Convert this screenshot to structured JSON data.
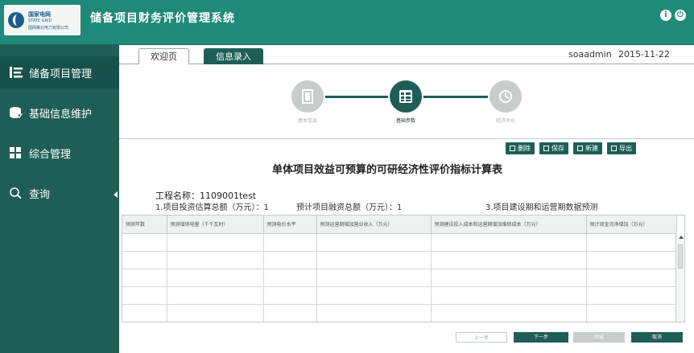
{
  "header": {
    "logo_line1": "国家电网",
    "logo_line2": "STATE GRID",
    "logo_line3": "国网冀北电力有限公司",
    "title": "储备项目财务评价管理系统"
  },
  "sidebar": {
    "items": [
      {
        "label": "储备项目管理",
        "icon": "list-icon"
      },
      {
        "label": "基础信息维护",
        "icon": "database-icon"
      },
      {
        "label": "综合管理",
        "icon": "grid-icon"
      },
      {
        "label": "查询",
        "icon": "search-icon"
      }
    ]
  },
  "tabs": [
    {
      "label": "欢迎页"
    },
    {
      "label": "信息录入"
    }
  ],
  "user": "soaadmin",
  "date": "2015-11-22",
  "steps": [
    {
      "label": "基本信息",
      "icon": "document-icon",
      "state": "inactive"
    },
    {
      "label": "基础参数",
      "icon": "list-grid-icon",
      "state": "active"
    },
    {
      "label": "经济评价",
      "icon": "chart-icon",
      "state": "inactive"
    }
  ],
  "toolbar": {
    "delete": "删除",
    "save": "保存",
    "new": "新建",
    "export": "导出"
  },
  "report": {
    "title": "单体项目效益可预算的可研经济性评价指标计算表",
    "project_name": "工程名称：1109001test",
    "info1": "1.项目投资估算总额（万元）：1",
    "info2": "预计项目融资总额（万元）：1",
    "info3": "3.项目建设期和运营期数据预测"
  },
  "table": {
    "columns": [
      "预测年数",
      "预测增供电量（千千瓦时）",
      "预测电价水平",
      "预测运营期增加营业收入（万元）",
      "预测建设投入成本和运营期增加维修成本（万元）",
      "预计现金流净增加（万元）"
    ],
    "rows": [
      [
        "",
        "",
        "",
        "",
        "",
        ""
      ],
      [
        "",
        "",
        "",
        "",
        "",
        ""
      ],
      [
        "",
        "",
        "",
        "",
        "",
        ""
      ],
      [
        "",
        "",
        "",
        "",
        "",
        ""
      ],
      [
        "",
        "",
        "",
        "",
        "",
        ""
      ]
    ]
  },
  "pager": {
    "prev": "上一步",
    "next": "下一步",
    "finish": "完成",
    "cancel": "取消"
  },
  "colors": {
    "primary": "#1f5e56",
    "header": "#1f8a79",
    "inactive": "#c8cccb"
  }
}
